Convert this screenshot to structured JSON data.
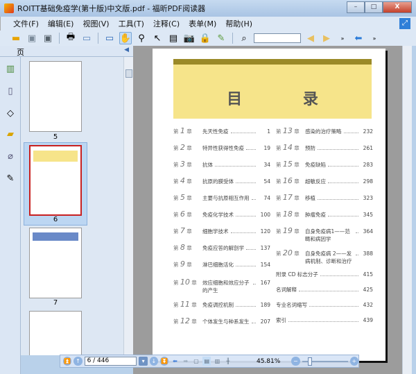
{
  "window": {
    "title": "ROITT基础免疫学(第十版)中文版.pdf - 福昕PDF阅读器",
    "min": "–",
    "max": "□",
    "close": "X"
  },
  "menu": [
    "文件(F)",
    "编辑(E)",
    "视图(V)",
    "工具(T)",
    "注释(C)",
    "表单(M)",
    "帮助(H)"
  ],
  "panel": {
    "title": "页",
    "thumbs": [
      {
        "label": "5"
      },
      {
        "label": "6"
      },
      {
        "label": "7"
      }
    ]
  },
  "search": {
    "value": ""
  },
  "doc": {
    "heading": "目 录",
    "left": [
      {
        "ch": "1",
        "t": "先天性免疫",
        "p": "1"
      },
      {
        "ch": "2",
        "t": "特异性获得性免疫",
        "p": "19"
      },
      {
        "ch": "3",
        "t": "抗体",
        "p": "34"
      },
      {
        "ch": "4",
        "t": "抗原的膜受体",
        "p": "54"
      },
      {
        "ch": "5",
        "t": "主要与抗原相互作用",
        "p": "74"
      },
      {
        "ch": "6",
        "t": "免疫化学技术",
        "p": "100"
      },
      {
        "ch": "7",
        "t": "细胞学技术",
        "p": "120"
      },
      {
        "ch": "8",
        "t": "免疫应答的解剖学",
        "p": "137"
      },
      {
        "ch": "9",
        "t": "淋巴细胞活化",
        "p": "154"
      },
      {
        "ch": "10",
        "t": "效应细胞和效应分子的产生",
        "p": "167"
      },
      {
        "ch": "11",
        "t": "免疫调控机制",
        "p": "189"
      },
      {
        "ch": "12",
        "t": "个体发生与种系发生",
        "p": "207"
      }
    ],
    "right": [
      {
        "ch": "13",
        "t": "感染的治疗策略",
        "p": "232"
      },
      {
        "ch": "14",
        "t": "预防",
        "p": "261"
      },
      {
        "ch": "15",
        "t": "免疫缺陷",
        "p": "283"
      },
      {
        "ch": "16",
        "t": "超敏反应",
        "p": "298"
      },
      {
        "ch": "17",
        "t": "移植",
        "p": "323"
      },
      {
        "ch": "18",
        "t": "肿瘤免疫",
        "p": "345"
      },
      {
        "ch": "19",
        "t": "自身免疫病1——范畴和病因学",
        "p": "364"
      },
      {
        "ch": "20",
        "t": "自身免疫病 2——发病机制、诊断和治疗",
        "p": "388"
      },
      {
        "ch": "",
        "t": "附录  CD 标志分子",
        "p": "415"
      },
      {
        "ch": "",
        "t": "名词解释",
        "p": "425"
      },
      {
        "ch": "",
        "t": "专业名词缩写",
        "p": "432"
      },
      {
        "ch": "",
        "t": "索引",
        "p": "439"
      }
    ],
    "ch_prefix": "第",
    "ch_suffix": "章"
  },
  "nav": {
    "page": "6 / 446",
    "zoom": "45.81%"
  }
}
